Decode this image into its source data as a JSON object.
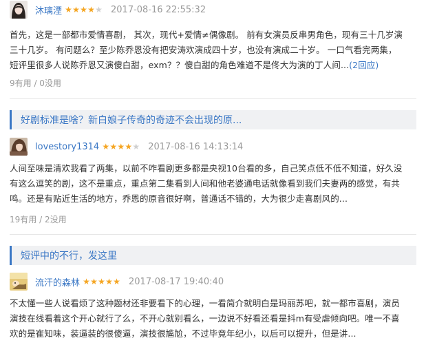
{
  "reviews": [
    {
      "username": "沐璃湮",
      "rating": 4,
      "time": "2017-08-16 22:55:32",
      "lines": [
        "首先，这是一部都市爱情喜剧， 其次，现代+爱情≠偶像剧。 前有女演员反串男角色，现有三十几岁演",
        "三十几岁。 有问题么？至少陈乔恩没有把安涛欢演成四十岁，也没有演成二十岁。 一口气看完两集，",
        "短评里很多人说陈乔恩又演傻白甜，exm？？傻白甜的角色难道不是佟大为演的丁人间..."
      ],
      "reply_link": "(2回应)",
      "votes": "9有用 / 0没用"
    },
    {
      "username": "lovestory1314",
      "rating": 4,
      "time": "2017-08-16 14:13:14",
      "lines": [
        "人间至味是清欢我看了两集，以前不咋看剧更多都是央视10台看的多，自己笑点低不低不知道，好久没",
        "有这么逗笑的剧，这不是重点，重点第二集看到人间和他老婆通电话就像看到我们夫妻两的感觉，有共",
        "鸣。还是有贴近生活的地方，乔恩的原音很好啊，普通话不错的，大为很少走喜剧风的..."
      ],
      "votes": "19有用 / 2没用"
    },
    {
      "username": "流汗的森林",
      "rating": 5,
      "time": "2017-08-17 19:40:40",
      "lines": [
        "不太懂一些人说看烦了这种题材还非要看下的心理，一看简介就明白是玛丽苏吧，就一都市喜剧，演员",
        "演技在线看着这个开心就行了么，不开心就别看么，一边说不好看还看是抖m有受虐倾向吧。唯一不喜",
        "欢的是崔知味，装逼装的很傻逼，演技很尴尬，不过毕竟年纪小，以后可以提升，但是讲..."
      ]
    }
  ],
  "threads": [
    {
      "title": "好剧标准是啥？新白娘子传奇的奇迹不会出现的原..."
    },
    {
      "title": "短评中的不行，发这里"
    }
  ],
  "colors": {
    "link": "#3a77c5",
    "star": "#f5a623",
    "muted": "#9a9a9a",
    "thread_bg": "#f0f1f3"
  }
}
